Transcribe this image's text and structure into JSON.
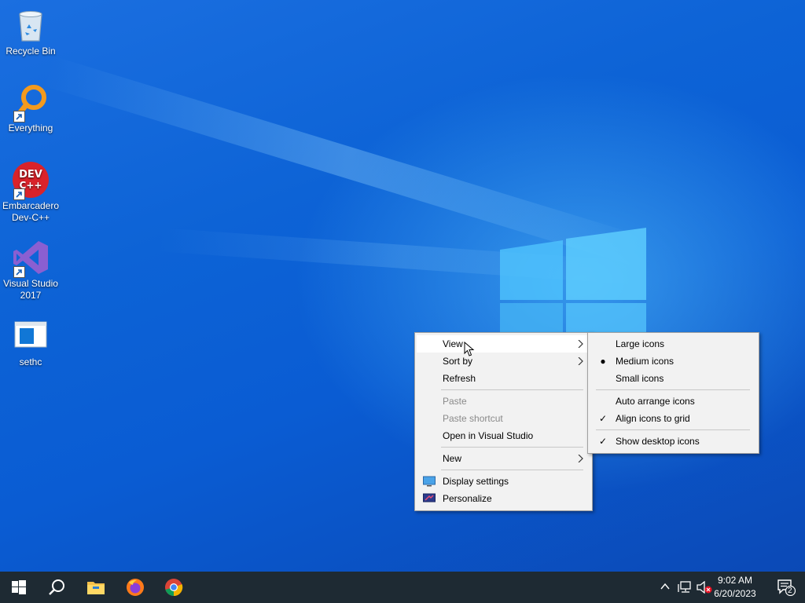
{
  "desktop_icons": [
    {
      "label": "Recycle Bin"
    },
    {
      "label": "Everything"
    },
    {
      "label": "Embarcadero Dev-C++"
    },
    {
      "label": "Visual Studio 2017"
    },
    {
      "label": "sethc"
    }
  ],
  "context_menu": {
    "view": "View",
    "sort_by": "Sort by",
    "refresh": "Refresh",
    "paste": "Paste",
    "paste_shortcut": "Paste shortcut",
    "open_vs": "Open in Visual Studio",
    "new": "New",
    "display_settings": "Display settings",
    "personalize": "Personalize"
  },
  "view_submenu": {
    "large_icons": "Large icons",
    "medium_icons": "Medium icons",
    "small_icons": "Small icons",
    "auto_arrange": "Auto arrange icons",
    "align_to_grid": "Align icons to grid",
    "show_desktop_icons": "Show desktop icons",
    "selected_size": "Medium icons",
    "checked": [
      "Align icons to grid",
      "Show desktop icons"
    ]
  },
  "taskbar": {
    "time": "9:02 AM",
    "date": "6/20/2023",
    "notification_count": "2",
    "pinned_icons": [
      "start-icon",
      "search-icon",
      "file-explorer-icon",
      "firefox-icon",
      "chrome-icon"
    ]
  },
  "colors": {
    "desktop_blue": "#0a5fd0",
    "taskbar": "#1e2a33",
    "menu_bg": "#f2f2f2"
  }
}
